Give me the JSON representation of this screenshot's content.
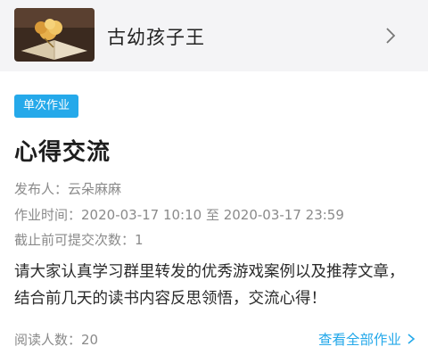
{
  "group": {
    "name": "古幼孩子王",
    "thumbnail_icon": "book-photo"
  },
  "assignment": {
    "badge": "单次作业",
    "title": "心得交流",
    "publisher_label": "发布人：",
    "publisher": "云朵麻麻",
    "time_label": "作业时间：",
    "time_range": "2020-03-17 10:10 至 2020-03-17 23:59",
    "deadline_label": "截止前可提交次数：",
    "deadline_count": "1",
    "description": "请大家认真学习群里转发的优秀游戏案例以及推荐文章，结合前几天的读书内容反思领悟，交流心得！",
    "reads_label": "阅读人数：",
    "reads_count": "20",
    "view_all": "查看全部作业"
  },
  "colors": {
    "accent": "#25a9ea",
    "header_bg": "#f4f4f6",
    "meta_text": "#8a8a8a"
  }
}
